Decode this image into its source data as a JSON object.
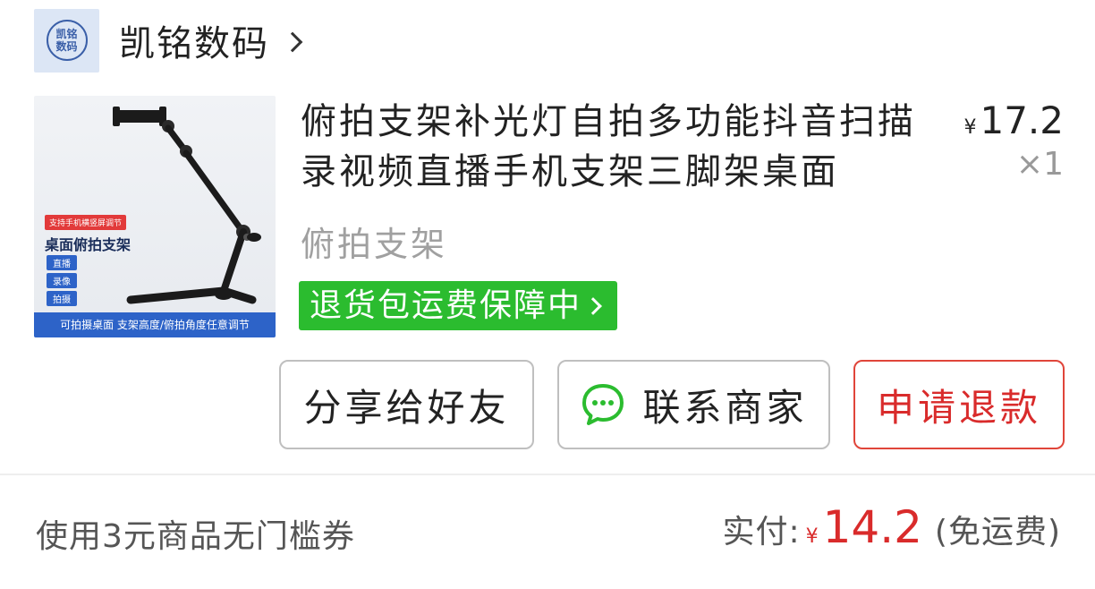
{
  "shop": {
    "logo_line1": "凯铭",
    "logo_line2": "数码",
    "name": "凯铭数码"
  },
  "product": {
    "image": {
      "tag": "支持手机横竖屏调节",
      "title": "桌面俯拍支架",
      "badges": [
        "直播",
        "录像",
        "拍摄"
      ],
      "caption": "可拍摄桌面 支架高度/俯拍角度任意调节"
    },
    "title": "俯拍支架补光灯自拍多功能抖音扫描录视频直播手机支架三脚架桌面",
    "spec": "俯拍支架",
    "price_symbol": "¥",
    "price": "17.2",
    "quantity": "×1",
    "guarantee": "退货包运费保障中"
  },
  "actions": {
    "share_label": "分享给好友",
    "contact_label": "联系商家",
    "refund_label": "申请退款"
  },
  "summary": {
    "coupon_text": "使用3元商品无门槛券",
    "paid_label": "实付:",
    "paid_symbol": "¥",
    "paid_amount": "14.2",
    "paid_note": "(免运费)"
  },
  "colors": {
    "accent_green": "#2bbc2f",
    "price_red": "#d92b2b",
    "refund_border": "#e0453a"
  },
  "icons": [
    "chevron-right-icon",
    "chat-bubble-icon"
  ]
}
